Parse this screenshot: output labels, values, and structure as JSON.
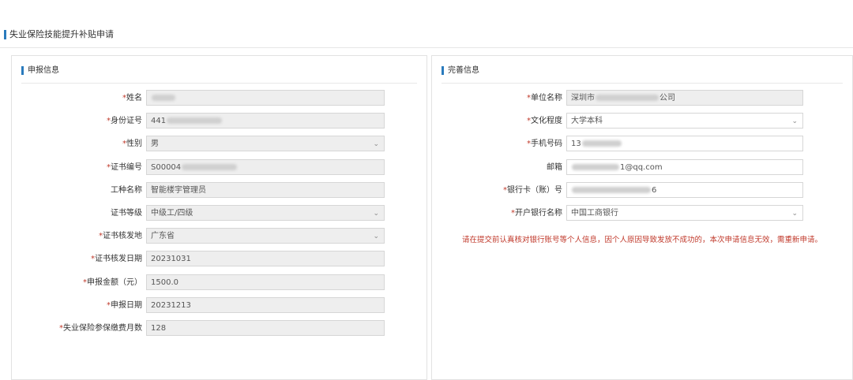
{
  "page": {
    "title": "失业保险技能提升补贴申请"
  },
  "left_panel": {
    "title": "申报信息",
    "fields": [
      {
        "label": "姓名",
        "required": true,
        "value": "",
        "masked": true,
        "type": "text"
      },
      {
        "label": "身份证号",
        "required": true,
        "value": "441",
        "masked": true,
        "type": "text"
      },
      {
        "label": "性别",
        "required": true,
        "value": "男",
        "type": "select"
      },
      {
        "label": "证书编号",
        "required": true,
        "value": "S00004",
        "masked": true,
        "type": "text"
      },
      {
        "label": "工种名称",
        "required": false,
        "value": "智能楼宇管理员",
        "type": "text"
      },
      {
        "label": "证书等级",
        "required": false,
        "value": "中级工/四级",
        "type": "select"
      },
      {
        "label": "证书核发地",
        "required": true,
        "value": "广东省",
        "type": "select"
      },
      {
        "label": "证书核发日期",
        "required": true,
        "value": "20231031",
        "type": "text"
      },
      {
        "label": "申报金额（元）",
        "required": true,
        "value": "1500.0",
        "type": "text"
      },
      {
        "label": "申报日期",
        "required": true,
        "value": "20231213",
        "type": "text"
      },
      {
        "label": "失业保险参保缴费月数",
        "required": true,
        "value": "128",
        "type": "text"
      }
    ]
  },
  "right_panel": {
    "title": "完善信息",
    "fields": [
      {
        "label": "单位名称",
        "required": true,
        "value": "深圳市",
        "suffix": "公司",
        "masked": true,
        "type": "text",
        "editable": false
      },
      {
        "label": "文化程度",
        "required": true,
        "value": "大学本科",
        "type": "select",
        "editable": true
      },
      {
        "label": "手机号码",
        "required": true,
        "value": "13",
        "masked": true,
        "type": "text",
        "editable": true
      },
      {
        "label": "邮箱",
        "required": false,
        "value": "",
        "suffix": "1@qq.com",
        "masked": true,
        "type": "text",
        "editable": true
      },
      {
        "label": "银行卡（账）号",
        "required": true,
        "value": "",
        "suffix": "6",
        "masked": true,
        "type": "text",
        "editable": true
      },
      {
        "label": "开户银行名称",
        "required": true,
        "value": "中国工商银行",
        "type": "select",
        "editable": true
      }
    ],
    "notice": "请在提交前认真核对银行账号等个人信息，因个人原因导致发放不成功的，本次申请信息无效，需重新申请。"
  },
  "colors": {
    "accent": "#2a7bbd",
    "required": "#c0392b",
    "readonly_bg": "#eeeeee"
  },
  "icons": {
    "select": "chevron-down-icon"
  }
}
